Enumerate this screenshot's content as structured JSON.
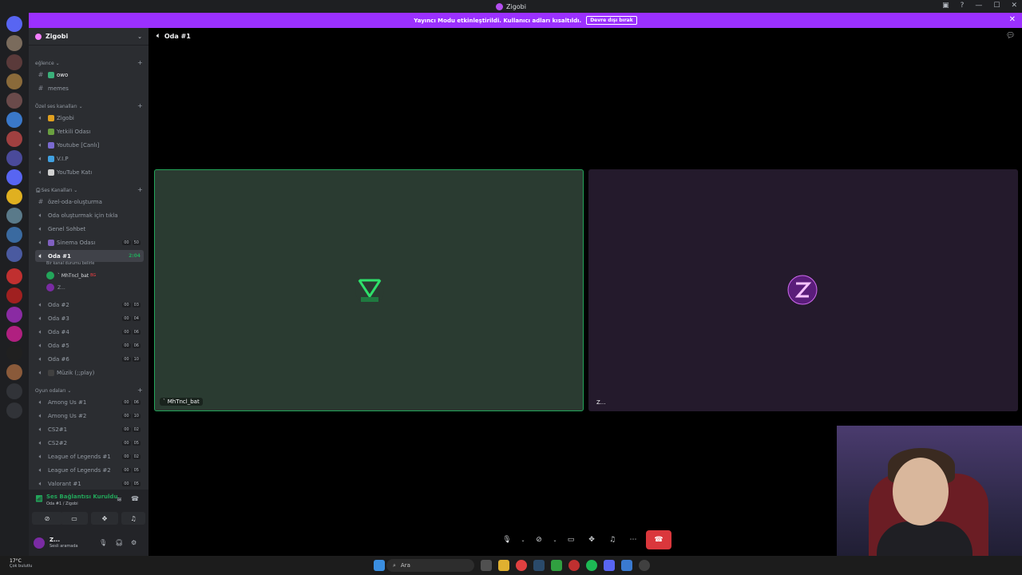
{
  "window": {
    "title": "Zigobi"
  },
  "banner": {
    "text": "Yayıncı Modu etkinleştirildi. Kullanıcı adları kısaltıldı.",
    "button": "Devre dışı bırak"
  },
  "server": {
    "name": "Zigobi"
  },
  "categories": [
    {
      "label": "eğlence"
    },
    {
      "label": "Özel ses kanalları"
    },
    {
      "label": "Ses Kanalları"
    },
    {
      "label": "Oyun odaları"
    }
  ],
  "channels": {
    "owo": "owo",
    "memes": "memes",
    "zigobi": "Zigobi",
    "yetkili": "Yetkili Odası",
    "youtube_canli": "Youtube [Canlı]",
    "vip": "V.I.P",
    "youtube_kati": "YouTube Katı",
    "ozel_oda": "özel-oda-oluşturma",
    "oda_olustur": "Oda oluşturmak için tıkla",
    "genel": "Genel Sohbet",
    "sinema": "Sinema Odası",
    "sinema_count": [
      "00",
      "50"
    ],
    "oda1": "Oda #1",
    "oda1_time": "2:04",
    "oda1_status": "Bir kanal durumu belirle",
    "oda2": "Oda #2",
    "oda2_count": [
      "00",
      "03"
    ],
    "oda3": "Oda #3",
    "oda3_count": [
      "00",
      "04"
    ],
    "oda4": "Oda #4",
    "oda4_count": [
      "00",
      "06"
    ],
    "oda5": "Oda #5",
    "oda5_count": [
      "00",
      "06"
    ],
    "oda6": "Oda #6",
    "oda6_count": [
      "00",
      "10"
    ],
    "muzik": "Müzik (;;play)",
    "among1": "Among Us #1",
    "among1_count": [
      "00",
      "06"
    ],
    "among2": "Among Us #2",
    "among2_count": [
      "00",
      "10"
    ],
    "cs1": "CS2#1",
    "cs1_count": [
      "00",
      "02"
    ],
    "cs2": "CS2#2",
    "cs2_count": [
      "00",
      "05"
    ],
    "lol1": "League of Legends #1",
    "lol1_count": [
      "00",
      "02"
    ],
    "lol2": "League of Legends #2",
    "lol2_count": [
      "00",
      "05"
    ],
    "valorant1": "Valorant #1",
    "valorant1_count": [
      "00",
      "05"
    ]
  },
  "voice_users": [
    {
      "name": "ˋ MhTncl_bat",
      "tag": "BG"
    },
    {
      "name": "Z..."
    }
  ],
  "voice_panel": {
    "status": "Ses Bağlantısı Kuruldu",
    "sub": "Oda #1 / Zigobi"
  },
  "user": {
    "name": "Z...",
    "status": "Sesli aramada"
  },
  "stage": {
    "title": "Oda #1"
  },
  "tiles": [
    {
      "label": "ˋ MhTncl_bat"
    },
    {
      "label": "Z..."
    }
  ],
  "taskbar": {
    "temp": "17°C",
    "weather": "Çok bulutlu",
    "search": "Ara"
  },
  "colors": {
    "accent": "#9b30ff",
    "speaking": "#23a55a",
    "hangup": "#da373c"
  }
}
